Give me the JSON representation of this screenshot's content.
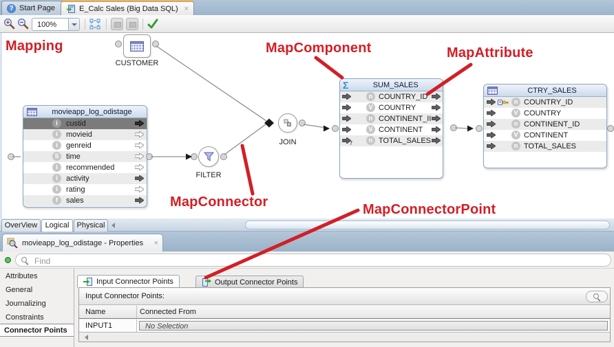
{
  "colors": {
    "annotation_red": "#d21f26",
    "tab_bar_blue": "#9db4ca",
    "table_header_blue": "#ccdaec",
    "selected_row_gray": "#7b7b7b"
  },
  "icons": {
    "help": "?",
    "close": "×",
    "validate_check": "validate",
    "dropdown": "▾"
  },
  "top_tabs": {
    "start": {
      "label": "Start Page"
    },
    "editor": {
      "label": "E_Calc Sales (Big Data SQL)"
    }
  },
  "toolbar": {
    "zoom_value": "100%"
  },
  "annotations": {
    "mapping": "Mapping",
    "map_component": "MapComponent",
    "map_attribute": "MapAttribute",
    "map_connector": "MapConnector",
    "map_connector_point": "MapConnectorPoint"
  },
  "canvas": {
    "customer": {
      "label": "CUSTOMER"
    },
    "filter": {
      "label": "FILTER"
    },
    "join": {
      "label": "JOIN"
    },
    "source_table": {
      "title": "movieapp_log_odistage",
      "columns": [
        {
          "name": "custid",
          "type": "i",
          "arrow": "filled",
          "state": "selected"
        },
        {
          "name": "movieid",
          "type": "i",
          "arrow": "hollow"
        },
        {
          "name": "genreid",
          "type": "i",
          "arrow": "hollow"
        },
        {
          "name": "time",
          "type": "S",
          "arrow": "hollow"
        },
        {
          "name": "recommended",
          "type": "i",
          "arrow": "hollow"
        },
        {
          "name": "activity",
          "type": "i",
          "arrow": "filled"
        },
        {
          "name": "rating",
          "type": "i",
          "arrow": "hollow"
        },
        {
          "name": "sales",
          "type": "f",
          "arrow": "filled"
        }
      ]
    },
    "sum_sales": {
      "title": "SUM_SALES",
      "sigma": "Σ",
      "columns": [
        {
          "name": "COUNTRY_ID",
          "type": "n"
        },
        {
          "name": "COUNTRY",
          "type": "V"
        },
        {
          "name": "CONTINENT_II",
          "type": "n"
        },
        {
          "name": "CONTINENT",
          "type": "V"
        },
        {
          "name": "TOTAL_SALES",
          "type": "n",
          "fn": "f"
        }
      ]
    },
    "ctry_sales": {
      "title": "CTRY_SALES",
      "columns": [
        {
          "name": "COUNTRY_ID",
          "type": "n",
          "key": "true"
        },
        {
          "name": "COUNTRY",
          "type": "V"
        },
        {
          "name": "CONTINENT_ID",
          "type": "n"
        },
        {
          "name": "CONTINENT",
          "type": "V"
        },
        {
          "name": "TOTAL_SALES",
          "type": "n"
        }
      ]
    }
  },
  "view_tabs": {
    "items": [
      {
        "label": "OverView"
      },
      {
        "label": "Logical"
      },
      {
        "label": "Physical"
      }
    ]
  },
  "properties": {
    "tab_title": "movieapp_log_odistage - Properties",
    "find_placeholder": "Find",
    "sidebar": [
      {
        "label": "Attributes"
      },
      {
        "label": "General"
      },
      {
        "label": "Journalizing"
      },
      {
        "label": "Constraints"
      },
      {
        "label": "Connector Points"
      }
    ],
    "tabs": [
      {
        "label": "Input Connector Points"
      },
      {
        "label": "Output Connector Points"
      }
    ],
    "section_label": "Input Connector Points:",
    "table": {
      "headers": [
        "Name",
        "Connected From"
      ],
      "rows": [
        {
          "name": "INPUT1",
          "connected_from": "No Selection"
        }
      ]
    }
  }
}
